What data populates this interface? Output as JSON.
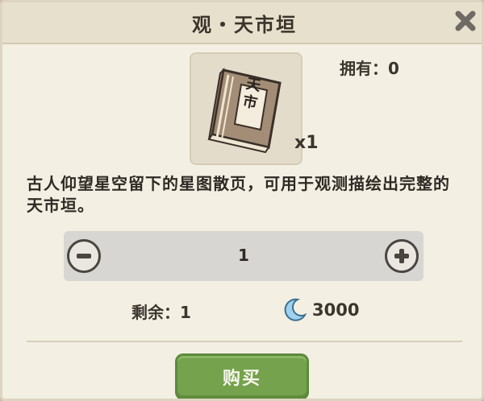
{
  "dialog": {
    "title": "观・天市垣",
    "owned_label": "拥有：0",
    "item_book_text": "天市",
    "item_quantity": "x1",
    "description": "古人仰望星空留下的星图散页，可用于观测描绘出完整的天市垣。",
    "stepper_value": "1",
    "remaining_label": "剩余：1",
    "price_value": "3000",
    "buy_label": "购买",
    "icons": {
      "close": "close-icon",
      "minus": "minus-icon",
      "plus": "plus-icon",
      "currency": "crescent-moon-icon",
      "item": "star-map-book-icon"
    },
    "colors": {
      "buy_button": "#74a24d",
      "currency_moon": "#9fd2ee"
    }
  }
}
